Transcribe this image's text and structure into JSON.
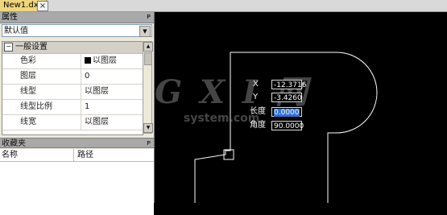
{
  "document_tab": {
    "title": "New1.dxf",
    "close_glyph": "×"
  },
  "properties_panel": {
    "title": "属性",
    "pin_glyph": "ᴘ",
    "selector_value": "默认值",
    "group": {
      "expander": "−",
      "label": "一般设置"
    },
    "rows": [
      {
        "name": "色彩",
        "value": "以图层",
        "swatch": true
      },
      {
        "name": "图层",
        "value": "0"
      },
      {
        "name": "线型",
        "value": "以图层"
      },
      {
        "name": "线型比例",
        "value": "1"
      },
      {
        "name": "线宽",
        "value": "以图层"
      }
    ]
  },
  "favorites_panel": {
    "title": "收藏夹",
    "pin_glyph": "ᴘ",
    "columns": [
      "名称",
      "路径"
    ]
  },
  "canvas": {
    "watermark": "G X I 网",
    "watermark_sub": "system.com",
    "coord_input": {
      "x_label": "X",
      "x_value": "-12.3716",
      "y_label": "Y",
      "y_value": "-3.4260",
      "length_label": "长度",
      "length_value": "0.0000",
      "angle_label": "角度",
      "angle_value": "90.0000"
    }
  },
  "colors": {
    "canvas_bg": "#000000",
    "drawing_stroke": "#ffffff",
    "panel_bg": "#ece9d8",
    "tab_active": "#f0d67a",
    "selection": "#3070d8"
  }
}
